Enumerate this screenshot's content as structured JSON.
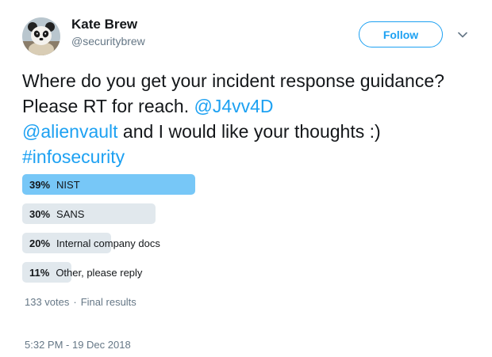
{
  "user": {
    "name": "Kate Brew",
    "handle": "@securitybrew"
  },
  "follow_label": "Follow",
  "tweet": {
    "text_1": "Where do you get your incident response guidance? Please RT for reach. ",
    "mention_1": "@J4vv4D",
    "mention_2": "@alienvault",
    "text_2": " and I would like your thoughts :) ",
    "hashtag": "#infosecurity"
  },
  "poll": {
    "options": [
      {
        "percent": "39%",
        "label": "NIST",
        "fraction": 0.39,
        "winner": true
      },
      {
        "percent": "30%",
        "label": "SANS",
        "fraction": 0.3,
        "winner": false
      },
      {
        "percent": "20%",
        "label": "Internal company docs",
        "fraction": 0.2,
        "winner": false
      },
      {
        "percent": "11%",
        "label": "Other, please reply",
        "fraction": 0.11,
        "winner": false
      }
    ],
    "votes": "133 votes",
    "separator": "·",
    "status": "Final results"
  },
  "timestamp": "5:32 PM - 19 Dec 2018",
  "colors": {
    "accent": "#1da1f2",
    "winner_bar": "#77c7f7",
    "bar": "#e1e8ed",
    "secondary_text": "#657786"
  },
  "icons": {
    "caret": "chevron-down-icon",
    "avatar": "panda-avatar"
  }
}
